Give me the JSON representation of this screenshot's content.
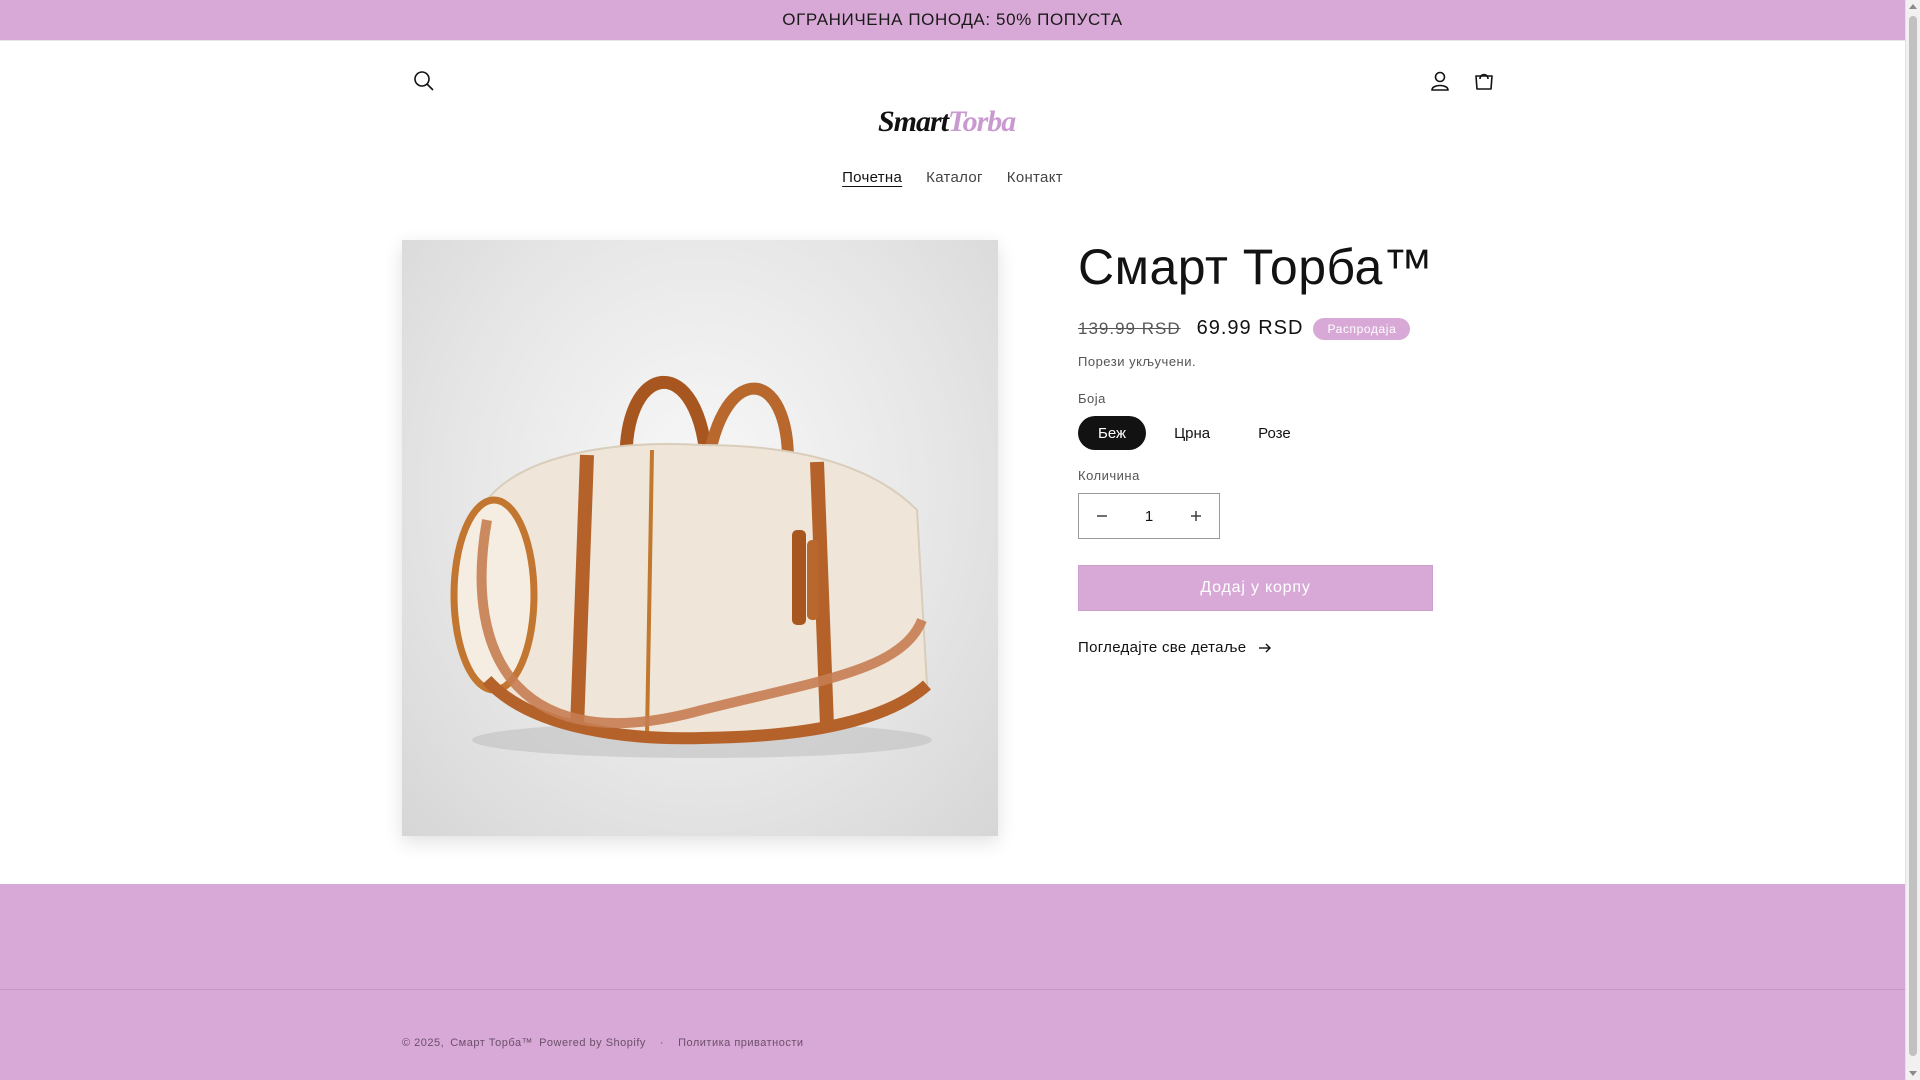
{
  "announcement": "ОГРАНИЧЕНА ПОНОДА: 50% ПОПУСТА",
  "header": {
    "logo_part1": "Smart",
    "logo_part2": "Torba",
    "nav": [
      "Почетна",
      "Каталог",
      "Контакт"
    ]
  },
  "icons": [
    "search-icon",
    "account-icon",
    "cart-icon",
    "arrow-right-icon"
  ],
  "product": {
    "title": "Смарт Торба™",
    "price_old": "139.99 RSD",
    "price_new": "69.99 RSD",
    "badge": "Распродаја",
    "tax_note": "Порези укључени.",
    "color_label": "Боја",
    "colors": [
      "Беж",
      "Црна",
      "Розе"
    ],
    "selected_color": "Беж",
    "quantity_label": "Количина",
    "quantity": "1",
    "add_to_cart": "Додај у корпу",
    "details_link": "Погледајте све детаље"
  },
  "footer": {
    "copyright": "© 2025,",
    "store_link": "Смарт Торба™",
    "powered": "Powered by Shopify",
    "privacy": "Политика приватности"
  },
  "colors": {
    "accent": "#d8a9d6",
    "text": "#121212"
  }
}
